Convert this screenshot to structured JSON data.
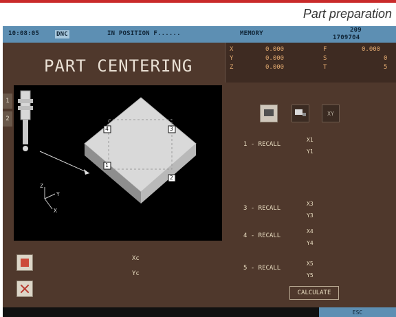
{
  "section": {
    "title": "Part preparation"
  },
  "status_bar": {
    "time": "10:08:05",
    "mode": "DNC",
    "status": "IN POSITION  F......",
    "memory": "MEMORY",
    "program": "209",
    "program_sub": "1709704"
  },
  "coords": {
    "axes": [
      "X",
      "Y",
      "Z"
    ],
    "values": [
      "0.000",
      "0.000",
      "0.000"
    ],
    "right_labels": [
      "F",
      "S",
      "T"
    ],
    "right_values": [
      "0.000",
      "0",
      "5"
    ]
  },
  "screen": {
    "title": "PART CENTERING"
  },
  "side_tabs": [
    "1",
    "2"
  ],
  "toolbar": {
    "third_label": "XY"
  },
  "viewport": {
    "points": [
      "4",
      "3",
      "1",
      "2"
    ],
    "axes": [
      "Z",
      "Y",
      "X"
    ]
  },
  "recall": [
    {
      "label": "1 - RECALL",
      "x": "X1",
      "y": "Y1"
    },
    {
      "label": "3 - RECALL",
      "x": "X3",
      "y": "Y3"
    },
    {
      "label": "4 - RECALL",
      "x": "X4",
      "y": "Y4"
    },
    {
      "label": "5 - RECALL",
      "x": "X5",
      "y": "Y5"
    }
  ],
  "center": {
    "xc": "Xc",
    "yc": "Yc"
  },
  "buttons": {
    "calculate": "CALCULATE",
    "bottom": "ESC"
  }
}
